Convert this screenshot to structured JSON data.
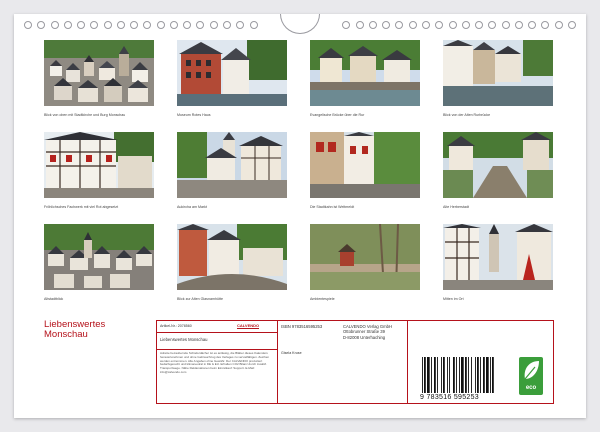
{
  "title": {
    "line1": "Liebenswertes",
    "line2": "Monschau"
  },
  "photos": [
    {
      "caption": "Blick von oben mit Stadtkirche und Burg Monschau"
    },
    {
      "caption": "Museum Rotes Haus"
    },
    {
      "caption": "Evangelische Brücke über die Rur"
    },
    {
      "caption": "Blick von der Alten Rurbrücke"
    },
    {
      "caption": "Fröhlichsches Fachwerk mit viel Rot abgesetzt"
    },
    {
      "caption": "Aukircha am Markt"
    },
    {
      "caption": "Die Stadtkahn ist Weltmeldt"
    },
    {
      "caption": "Alte Herberstadt"
    },
    {
      "caption": "Altstadtblick"
    },
    {
      "caption": "Blick zur Alten Glasnamhütte"
    },
    {
      "caption": "Ambientespiele"
    },
    {
      "caption": "Mitten im Ort"
    }
  ],
  "info": {
    "article_no": "Artikel-Nr.: 2078560",
    "calvendo_logo": "CALVENDO",
    "isbn": "ISBN 9783516595253",
    "publisher_lines": [
      "CALVENDO Verlag GmbH",
      "Ottobrunner Straße 39",
      "D-82008 Unterhaching"
    ],
    "calendar_title": "Liebenswertes Monschau",
    "author": "Gisela Kruse",
    "description": "Adrette bezaubernde Schieferdächer ist es anlässig, die Blätter dieses Kalenders herauszunehmen und ohne Gebrauchzug des Verlages zu vervielfältigen. Zeichen werden entnommen. Alle Angaben ohne Gewähr. Der CALVENDO produziert bedarfsgerecht und klimaneutral in DE & EU. Erhalten CO2 Bilanz durch zusätzl. Transportwege. Nähe Reklamationen beim Einzelkauf: Support. E-Mail: info@calvendo.com",
    "barcode_number": "9 783516 595253",
    "eco_label": "eco"
  },
  "colors": {
    "accent": "#b5121b",
    "eco": "#3b9e3b"
  }
}
